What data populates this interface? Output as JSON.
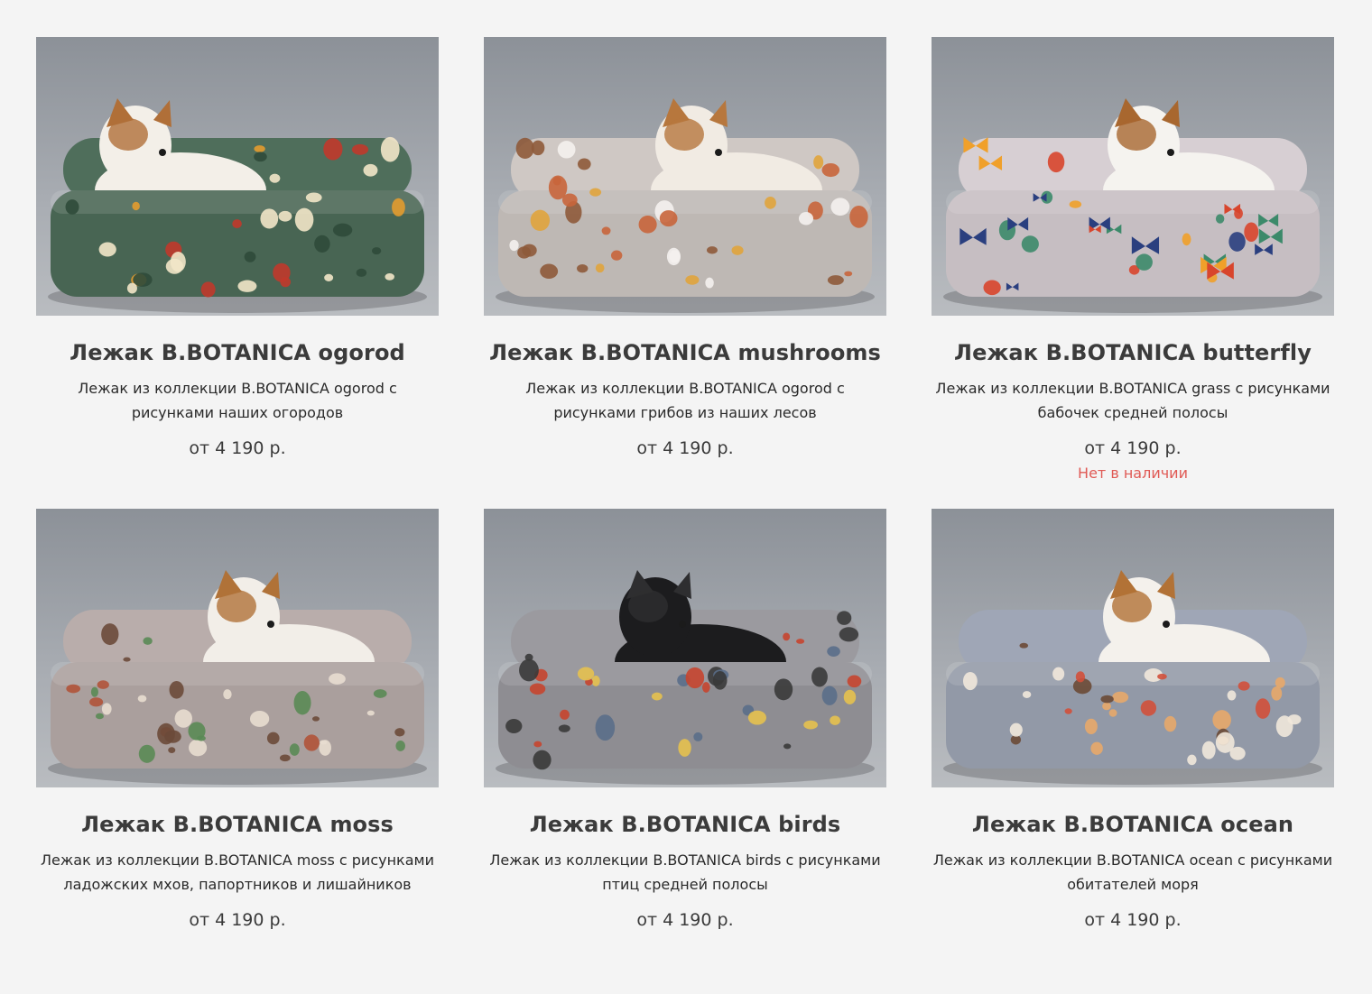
{
  "products": [
    {
      "title": "Лежак B.BOTANICA ogorod",
      "description": "Лежак из коллекции B.BOTANICA ogorod с рисунками наших огородов",
      "price": "от 4 190 р.",
      "stock": "",
      "fabric_color": "#4f6e5b",
      "pattern_colors": [
        "#c0392b",
        "#e39b2f",
        "#f2e6c8",
        "#2f4a3a"
      ],
      "dog_color": "#f3efe8",
      "dog_accent": "#b06f38"
    },
    {
      "title": "Лежак B.BOTANICA mushrooms",
      "description": "Лежак из коллекции B.BOTANICA ogorod с рисунками грибов из наших лесов",
      "price": "от 4 190 р.",
      "stock": "",
      "fabric_color": "#cfc8c4",
      "pattern_colors": [
        "#c8653b",
        "#e0a43c",
        "#8e5a3a",
        "#f4f1ee"
      ],
      "dog_color": "#f1ebe3",
      "dog_accent": "#b7773d"
    },
    {
      "title": "Лежак B.BOTANICA butterfly",
      "description": "Лежак из коллекции B.BOTANICA grass с рисунками бабочек средней полосы",
      "price": "от 4 190 р.",
      "stock": "Нет в наличии",
      "stock_color": "#e05a55",
      "fabric_color": "#d7cfd3",
      "pattern_colors": [
        "#d8452c",
        "#2a3f7f",
        "#f0a02a",
        "#3c8a6a"
      ],
      "dog_color": "#f5f3ef",
      "dog_accent": "#a8672f"
    },
    {
      "title": "Лежак B.BOTANICA moss",
      "description": "Лежак из коллекции B.BOTANICA moss с рисунками ладожских мхов, папортников и лишайников",
      "price": "от 4 190 р.",
      "stock": "",
      "fabric_color": "#b9adab",
      "pattern_colors": [
        "#5a8a55",
        "#b0533a",
        "#e8ddd0",
        "#6b4a3a"
      ],
      "dog_color": "#f2eee8",
      "dog_accent": "#b07238"
    },
    {
      "title": "Лежак B.BOTANICA birds",
      "description": "Лежак из коллекции B.BOTANICA birds с рисунками птиц средней полосы",
      "price": "от 4 190 р.",
      "stock": "",
      "fabric_color": "#9b9a9f",
      "pattern_colors": [
        "#c7452f",
        "#3a3a3a",
        "#e6c14f",
        "#5a6e8a"
      ],
      "dog_color": "#1c1c1e",
      "dog_accent": "#2e2e30"
    },
    {
      "title": "Лежак B.BOTANICA ocean",
      "description": "Лежак из коллекции B.BOTANICA ocean с рисунками обитателей моря",
      "price": "от 4 190 р.",
      "stock": "",
      "fabric_color": "#9fa6b6",
      "pattern_colors": [
        "#d1503b",
        "#e8a86a",
        "#6b4a36",
        "#f1e8dc"
      ],
      "dog_color": "#f4f1ec",
      "dog_accent": "#b27236"
    }
  ]
}
